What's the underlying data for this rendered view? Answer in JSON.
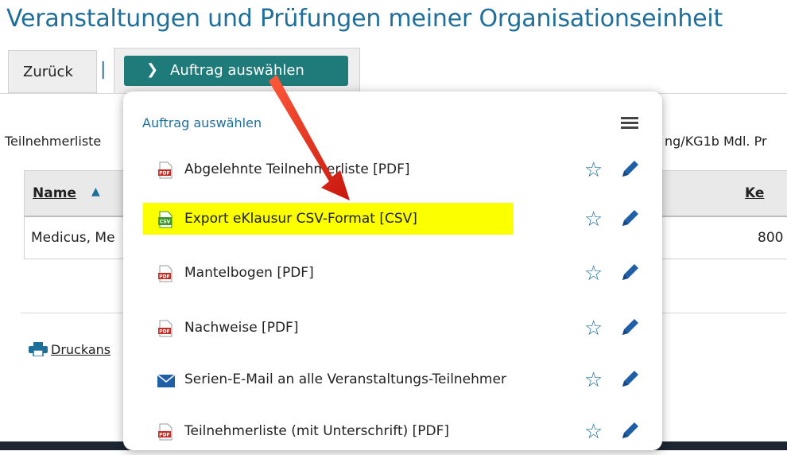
{
  "page": {
    "title": "Veranstaltungen und Prüfungen meiner Organisationseinheit"
  },
  "toolbar": {
    "back_label": "Zurück",
    "separator": "|",
    "primary_label": "Auftrag auswählen"
  },
  "meta": {
    "left_text": "Teilnehmerliste",
    "right_text": "ng/KG1b Mdl. Pr"
  },
  "table": {
    "headers": {
      "name": "Name",
      "right": "Ke"
    },
    "rows": [
      {
        "name": "Medicus, Me",
        "right": "800"
      }
    ]
  },
  "print_link": {
    "label": "Druckans"
  },
  "dropdown": {
    "title": "Auftrag auswählen",
    "items": [
      {
        "label": "Abgelehnte Teilnehmerliste  [PDF]",
        "icon": "pdf-icon",
        "highlight": false
      },
      {
        "label": "Export eKlausur CSV-Format  [CSV]",
        "icon": "csv-icon",
        "highlight": true
      },
      {
        "label": "Mantelbogen  [PDF]",
        "icon": "pdf-icon",
        "highlight": false
      },
      {
        "label": "Nachweise  [PDF]",
        "icon": "pdf-icon",
        "highlight": false
      },
      {
        "label": "Serien-E-Mail an alle Veranstaltungs-Teilnehmer",
        "icon": "mail-icon",
        "highlight": false
      },
      {
        "label": "Teilnehmerliste (mit Unterschrift)  [PDF]",
        "icon": "pdf-icon",
        "highlight": false
      }
    ]
  },
  "colors": {
    "title_blue": "#1f6f9b",
    "button_teal": "#1f7a7a",
    "highlight_yellow": "#fbff00",
    "arrow_red": "#e0241b",
    "pdf_red": "#c62b23",
    "csv_green": "#3a9a2a"
  }
}
